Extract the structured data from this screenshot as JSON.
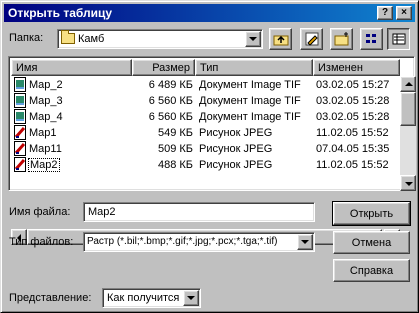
{
  "window": {
    "title": "Открыть таблицу",
    "help_glyph": "?",
    "close_glyph": "×"
  },
  "folder": {
    "label": "Папка:",
    "value": "Камб"
  },
  "columns": {
    "name": "Имя",
    "size": "Размер",
    "type": "Тип",
    "modified": "Изменен"
  },
  "files": [
    {
      "name": "Map_2",
      "size": "6 489 КБ",
      "type": "Документ Image TIF",
      "modified": "03.02.05 15:27",
      "kind": "tif"
    },
    {
      "name": "Map_3",
      "size": "6 560 КБ",
      "type": "Документ Image TIF",
      "modified": "03.02.05 15:28",
      "kind": "tif"
    },
    {
      "name": "Map_4",
      "size": "6 560 КБ",
      "type": "Документ Image TIF",
      "modified": "03.02.05 15:28",
      "kind": "tif"
    },
    {
      "name": "Map1",
      "size": "549 КБ",
      "type": "Рисунок JPEG",
      "modified": "11.02.05 15:52",
      "kind": "jpg"
    },
    {
      "name": "Map11",
      "size": "509 КБ",
      "type": "Рисунок JPEG",
      "modified": "07.04.05 15:35",
      "kind": "jpg"
    },
    {
      "name": "Map2",
      "size": "488 КБ",
      "type": "Рисунок JPEG",
      "modified": "11.02.05 15:52",
      "kind": "jpg"
    }
  ],
  "filename": {
    "label": "Имя файла:",
    "value": "Map2"
  },
  "filetype": {
    "label": "Тип файлов:",
    "value": "Растр (*.bil;*.bmp;*.gif;*.jpg;*.pcx;*.tga;*.tif)"
  },
  "view": {
    "label": "Представление:",
    "value": "Как получится"
  },
  "buttons": {
    "open": "Открыть",
    "cancel": "Отмена",
    "help": "Справка"
  },
  "colors": {
    "title_start": "#000080",
    "title_end": "#1084d0",
    "face": "#c0c0c0"
  }
}
